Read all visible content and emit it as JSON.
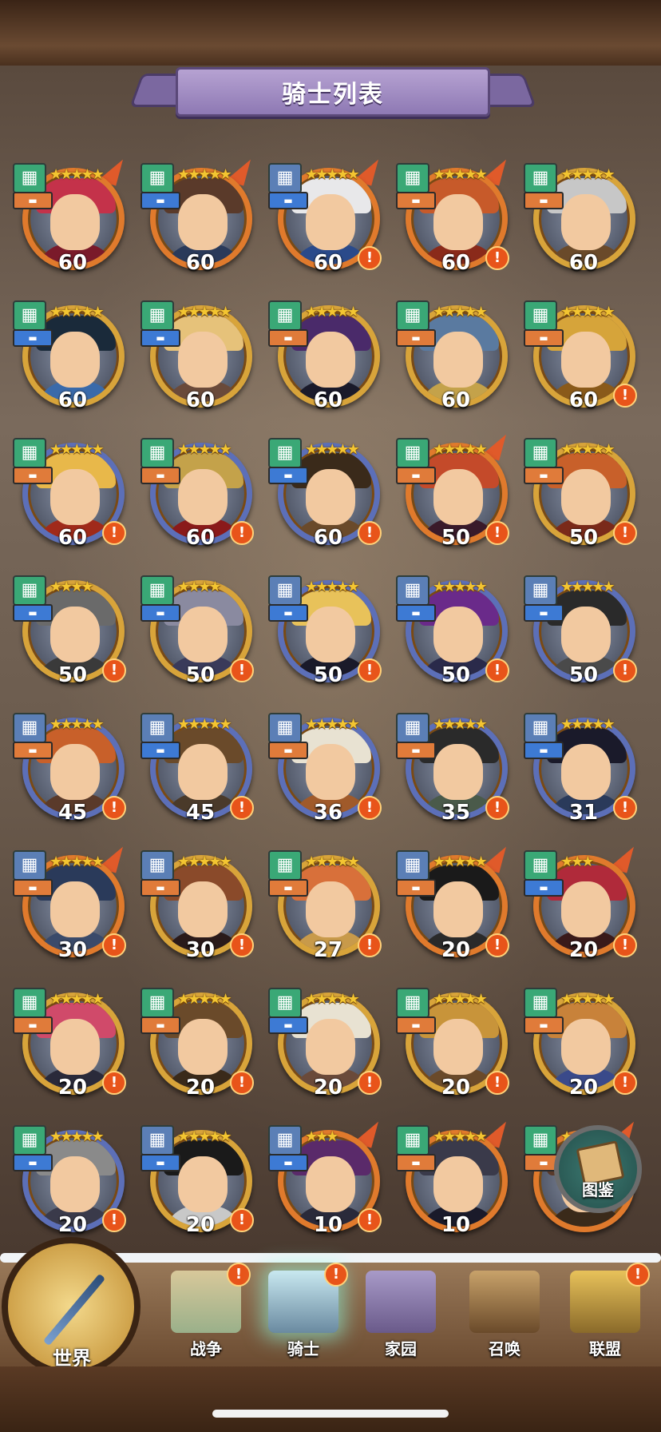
{
  "screen": {
    "title": "骑士列表"
  },
  "knights": [
    {
      "level": "60",
      "stars": "★★★★★",
      "class_icon": "green",
      "role": "orange",
      "alert": false,
      "rank": "orange",
      "hair": "#c4324a",
      "body": "#7a1a2a"
    },
    {
      "level": "60",
      "stars": "★★★★★",
      "class_icon": "green",
      "role": "blue",
      "alert": false,
      "rank": "orange",
      "hair": "#5a3a2a",
      "body": "#2a3a5a"
    },
    {
      "level": "60",
      "stars": "★★★★★",
      "class_icon": "blue",
      "role": "blue",
      "alert": true,
      "rank": "orange",
      "hair": "#e8e8ea",
      "body": "#2a4a8a"
    },
    {
      "level": "60",
      "stars": "★★★★★",
      "class_icon": "green",
      "role": "orange",
      "alert": true,
      "rank": "orange",
      "hair": "#c75a2a",
      "body": "#8a2a1a"
    },
    {
      "level": "60",
      "stars": "★★★★★",
      "class_icon": "green",
      "role": "orange",
      "alert": false,
      "rank": "gold",
      "hair": "#c7c7c7",
      "body": "#6a4a2a"
    },
    {
      "level": "60",
      "stars": "★★★★★",
      "class_icon": "green",
      "role": "blue",
      "alert": false,
      "rank": "gold",
      "hair": "#1a2a3a",
      "body": "#3a6aaa"
    },
    {
      "level": "60",
      "stars": "★★★★★",
      "class_icon": "green",
      "role": "blue",
      "alert": false,
      "rank": "gold",
      "hair": "#e6c27a",
      "body": "#6a4a3a"
    },
    {
      "level": "60",
      "stars": "★★★★★",
      "class_icon": "green",
      "role": "orange",
      "alert": false,
      "rank": "gold",
      "hair": "#4a2a6a",
      "body": "#1a1a2a"
    },
    {
      "level": "60",
      "stars": "★★★★★",
      "class_icon": "green",
      "role": "orange",
      "alert": false,
      "rank": "gold",
      "hair": "#5a7aa0",
      "body": "#c4a24a"
    },
    {
      "level": "60",
      "stars": "★★★★★",
      "class_icon": "green",
      "role": "orange",
      "alert": true,
      "rank": "gold",
      "hair": "#d6a43a",
      "body": "#8a5a1a"
    },
    {
      "level": "60",
      "stars": "★★★★★",
      "class_icon": "green",
      "role": "orange",
      "alert": true,
      "rank": "blue",
      "hair": "#e8b84a",
      "body": "#a02a1a"
    },
    {
      "level": "60",
      "stars": "★★★★★",
      "class_icon": "green",
      "role": "orange",
      "alert": true,
      "rank": "blue",
      "hair": "#c4a24a",
      "body": "#8a1a1a"
    },
    {
      "level": "60",
      "stars": "★★★★★",
      "class_icon": "green",
      "role": "blue",
      "alert": true,
      "rank": "blue",
      "hair": "#3a2a1a",
      "body": "#6a4a2a"
    },
    {
      "level": "50",
      "stars": "★★★★★",
      "class_icon": "green",
      "role": "orange",
      "alert": true,
      "rank": "orange",
      "hair": "#c44a2a",
      "body": "#3a1a2a"
    },
    {
      "level": "50",
      "stars": "★★★★★",
      "class_icon": "green",
      "role": "orange",
      "alert": true,
      "rank": "gold",
      "hair": "#c8602a",
      "body": "#7a2a1a"
    },
    {
      "level": "50",
      "stars": "★★★★",
      "class_icon": "green",
      "role": "blue",
      "alert": true,
      "rank": "gold",
      "hair": "#6a6a6a",
      "body": "#3a3a3a"
    },
    {
      "level": "50",
      "stars": "★★★★",
      "class_icon": "green",
      "role": "blue",
      "alert": true,
      "rank": "gold",
      "hair": "#8a8aa0",
      "body": "#3a3a5a"
    },
    {
      "level": "50",
      "stars": "★★★★★",
      "class_icon": "blue",
      "role": "blue",
      "alert": true,
      "rank": "blue",
      "hair": "#e8c25a",
      "body": "#1a1a2a"
    },
    {
      "level": "50",
      "stars": "★★★★★",
      "class_icon": "blue",
      "role": "blue",
      "alert": true,
      "rank": "blue",
      "hair": "#6a2a8a",
      "body": "#2a2a4a"
    },
    {
      "level": "50",
      "stars": "★★★★★",
      "class_icon": "blue",
      "role": "blue",
      "alert": true,
      "rank": "blue",
      "hair": "#2a2a2a",
      "body": "#4a4a4a"
    },
    {
      "level": "45",
      "stars": "★★★★★",
      "class_icon": "blue",
      "role": "orange",
      "alert": true,
      "rank": "blue",
      "hair": "#c8602a",
      "body": "#5a3a2a"
    },
    {
      "level": "45",
      "stars": "★★★★★",
      "class_icon": "blue",
      "role": "blue",
      "alert": true,
      "rank": "blue",
      "hair": "#6a4a2a",
      "body": "#4a3a2a"
    },
    {
      "level": "36",
      "stars": "★★★★★",
      "class_icon": "blue",
      "role": "orange",
      "alert": true,
      "rank": "blue",
      "hair": "#e8e2d2",
      "body": "#a05a2a"
    },
    {
      "level": "35",
      "stars": "★★★★★",
      "class_icon": "blue",
      "role": "orange",
      "alert": true,
      "rank": "blue",
      "hair": "#2a2a2a",
      "body": "#4a5a4a"
    },
    {
      "level": "31",
      "stars": "★★★★★",
      "class_icon": "blue",
      "role": "blue",
      "alert": true,
      "rank": "blue",
      "hair": "#1a1a2a",
      "body": "#2a3a5a"
    },
    {
      "level": "30",
      "stars": "★★★★★",
      "class_icon": "blue",
      "role": "orange",
      "alert": true,
      "rank": "orange",
      "hair": "#2a3a5a",
      "body": "#3a4a6a"
    },
    {
      "level": "30",
      "stars": "★★★★★",
      "class_icon": "blue",
      "role": "orange",
      "alert": true,
      "rank": "gold",
      "hair": "#8a4a2a",
      "body": "#2a1a1a"
    },
    {
      "level": "27",
      "stars": "★★★★★",
      "class_icon": "green",
      "role": "orange",
      "alert": true,
      "rank": "gold",
      "hair": "#d8703a",
      "body": "#c89a4a"
    },
    {
      "level": "20",
      "stars": "★★★★★",
      "class_icon": "blue",
      "role": "orange",
      "alert": true,
      "rank": "orange",
      "hair": "#1a1a1a",
      "body": "#2a2a2a"
    },
    {
      "level": "20",
      "stars": "★★★",
      "class_icon": "green",
      "role": "blue",
      "alert": true,
      "rank": "orange",
      "hair": "#b02a3a",
      "body": "#3a1a1a"
    },
    {
      "level": "20",
      "stars": "★★★★★",
      "class_icon": "green",
      "role": "orange",
      "alert": true,
      "rank": "gold",
      "hair": "#d04a6a",
      "body": "#2a2a3a"
    },
    {
      "level": "20",
      "stars": "★★★★★",
      "class_icon": "green",
      "role": "orange",
      "alert": true,
      "rank": "gold",
      "hair": "#6a4a2a",
      "body": "#3a2a1a"
    },
    {
      "level": "20",
      "stars": "★★★★★",
      "class_icon": "green",
      "role": "blue",
      "alert": true,
      "rank": "gold",
      "hair": "#e8e2d2",
      "body": "#6a4a3a"
    },
    {
      "level": "20",
      "stars": "★★★★★",
      "class_icon": "green",
      "role": "orange",
      "alert": true,
      "rank": "gold",
      "hair": "#c8943a",
      "body": "#6a4a2a"
    },
    {
      "level": "20",
      "stars": "★★★★★",
      "class_icon": "green",
      "role": "orange",
      "alert": true,
      "rank": "gold",
      "hair": "#c8823a",
      "body": "#3a4a8a"
    },
    {
      "level": "20",
      "stars": "★★★★★",
      "class_icon": "green",
      "role": "blue",
      "alert": true,
      "rank": "blue",
      "hair": "#8a8a8a",
      "body": "#3a3a4a"
    },
    {
      "level": "20",
      "stars": "★★★★★",
      "class_icon": "blue",
      "role": "blue",
      "alert": true,
      "rank": "gold",
      "hair": "#1a1a1a",
      "body": "#c8c8c8"
    },
    {
      "level": "10",
      "stars": "★★★",
      "class_icon": "blue",
      "role": "blue",
      "alert": true,
      "rank": "orange",
      "hair": "#5a2a6a",
      "body": "#2a2a3a"
    },
    {
      "level": "10",
      "stars": "★★★★★",
      "class_icon": "green",
      "role": "orange",
      "alert": false,
      "rank": "orange",
      "hair": "#3a3a4a",
      "body": "#1a1a2a"
    },
    {
      "level": "",
      "stars": "★★★★★",
      "class_icon": "green",
      "role": "orange",
      "alert": false,
      "rank": "orange",
      "hair": "#5a3a2a",
      "body": "#3a2a1a"
    }
  ],
  "codex_button": {
    "label": "图鉴"
  },
  "nav": {
    "world": "世界",
    "war": "战争",
    "knight": "骑士",
    "home": "家园",
    "summon": "召唤",
    "alliance": "联盟"
  },
  "badges": {
    "alert": "!"
  }
}
